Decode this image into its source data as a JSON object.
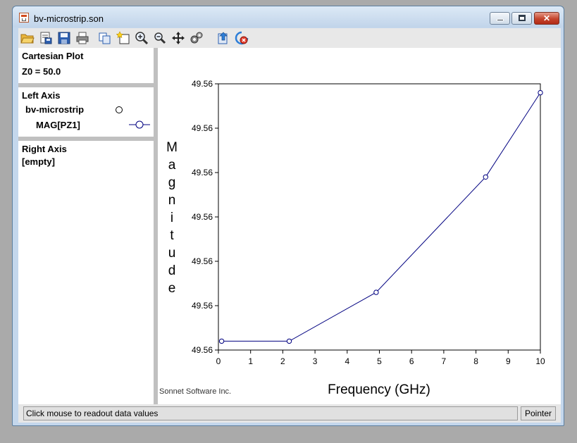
{
  "window": {
    "title": "bv-microstrip.son"
  },
  "toolbar": {
    "icons": [
      "open-folder-icon",
      "save-as-icon",
      "save-icon",
      "print-icon",
      "copy-icon",
      "new-plot-icon",
      "zoom-in-icon",
      "zoom-out-icon",
      "pan-icon",
      "settings-icon",
      "export-icon",
      "close-plot-icon"
    ]
  },
  "panel": {
    "plot_type": "Cartesian Plot",
    "z0": "Z0 = 50.0",
    "left_axis_label": "Left Axis",
    "project_name": "bv-microstrip",
    "measurement": "MAG[PZ1]",
    "right_axis_label": "Right Axis",
    "right_axis_value": "[empty]"
  },
  "plot": {
    "watermark": "Sonnet Software Inc."
  },
  "chart_data": {
    "type": "line",
    "xlabel": "Frequency (GHz)",
    "ylabel": "Magnitude",
    "xlim": [
      0,
      10
    ],
    "ylim": [
      0,
      6
    ],
    "x_ticks": [
      "0",
      "1",
      "2",
      "3",
      "4",
      "5",
      "6",
      "7",
      "8",
      "9",
      "10"
    ],
    "y_ticks": [
      "49.56",
      "49.56",
      "49.56",
      "49.56",
      "49.56",
      "49.56",
      "49.56"
    ],
    "grid": false,
    "series": [
      {
        "name": "MAG[PZ1]",
        "color": "#000080",
        "x": [
          0.1,
          2.2,
          4.9,
          8.3,
          10.0
        ],
        "y": [
          0.2,
          0.2,
          1.3,
          3.9,
          5.8
        ]
      }
    ]
  },
  "status": {
    "message": "Click mouse to readout data values",
    "mode": "Pointer"
  }
}
